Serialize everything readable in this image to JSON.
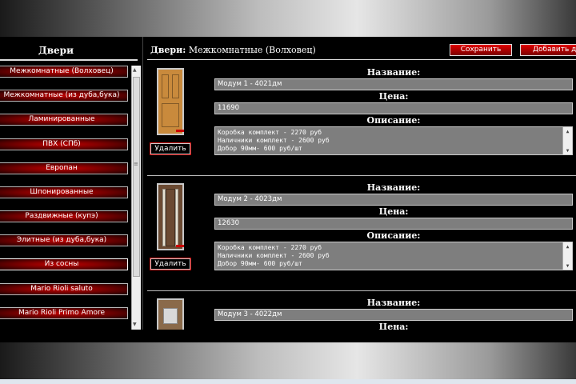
{
  "sidebar": {
    "title": "Двери",
    "items": [
      {
        "label": "Межкомнатные (Волховец)"
      },
      {
        "label": "Межкомнатные (из дуба,бука)"
      },
      {
        "label": "Ламинированные"
      },
      {
        "label": "ПВХ (СПб)"
      },
      {
        "label": "Европан"
      },
      {
        "label": "Шпонированные"
      },
      {
        "label": "Раздвижные (купэ)"
      },
      {
        "label": "Элитные (из дуба,бука)"
      },
      {
        "label": "Из сосны"
      },
      {
        "label": "Mario Rioli saluto"
      },
      {
        "label": "Mario Rioli Primo Amore"
      }
    ]
  },
  "main": {
    "title_bold": "Двери:",
    "title_rest": " Межкомнатные (Волховец)",
    "save_label": "Сохранить",
    "add_label": "Добавить дверь",
    "labels": {
      "name": "Название:",
      "price": "Цена:",
      "description": "Описание:",
      "delete": "Удалить"
    },
    "products": [
      {
        "name": "Модум 1 - 4021дм",
        "price": "11690",
        "description": "Коробка комплект - 2270 руб\nНаличники комплект - 2600 руб\nДобор 90мм- 600 руб/шт",
        "door_color": "#c98a3c"
      },
      {
        "name": "Модум 2 - 4023дм",
        "price": "12630",
        "description": "Коробка комплект - 2270 руб\nНаличники комплект - 2600 руб\nДобор 90мм- 600 руб/шт",
        "door_color": "#6b4a32"
      },
      {
        "name": "Модум 3 - 4022дм",
        "price": "",
        "description": "",
        "door_color": "#8a6a4a"
      }
    ]
  },
  "colors": {
    "accent": "#c00000",
    "field_bg": "#7e7e7e"
  }
}
